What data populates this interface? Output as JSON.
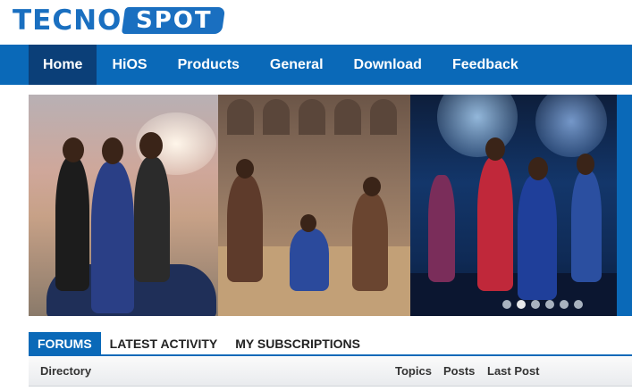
{
  "logo": {
    "part1": "TECNO",
    "part2": "SPOT"
  },
  "nav": {
    "items": [
      {
        "label": "Home",
        "active": true
      },
      {
        "label": "HiOS"
      },
      {
        "label": "Products"
      },
      {
        "label": "General"
      },
      {
        "label": "Download"
      },
      {
        "label": "Feedback"
      }
    ]
  },
  "carousel": {
    "slide_count": 6,
    "active_index": 1
  },
  "tabs": [
    {
      "label": "FORUMS",
      "active": true
    },
    {
      "label": "LATEST ACTIVITY"
    },
    {
      "label": "MY SUBSCRIPTIONS"
    }
  ],
  "table": {
    "col_directory": "Directory",
    "col_topics": "Topics",
    "col_posts": "Posts",
    "col_last_post": "Last Post"
  },
  "colors": {
    "brand_blue": "#0a69b8",
    "nav_active": "#0b3f78"
  }
}
